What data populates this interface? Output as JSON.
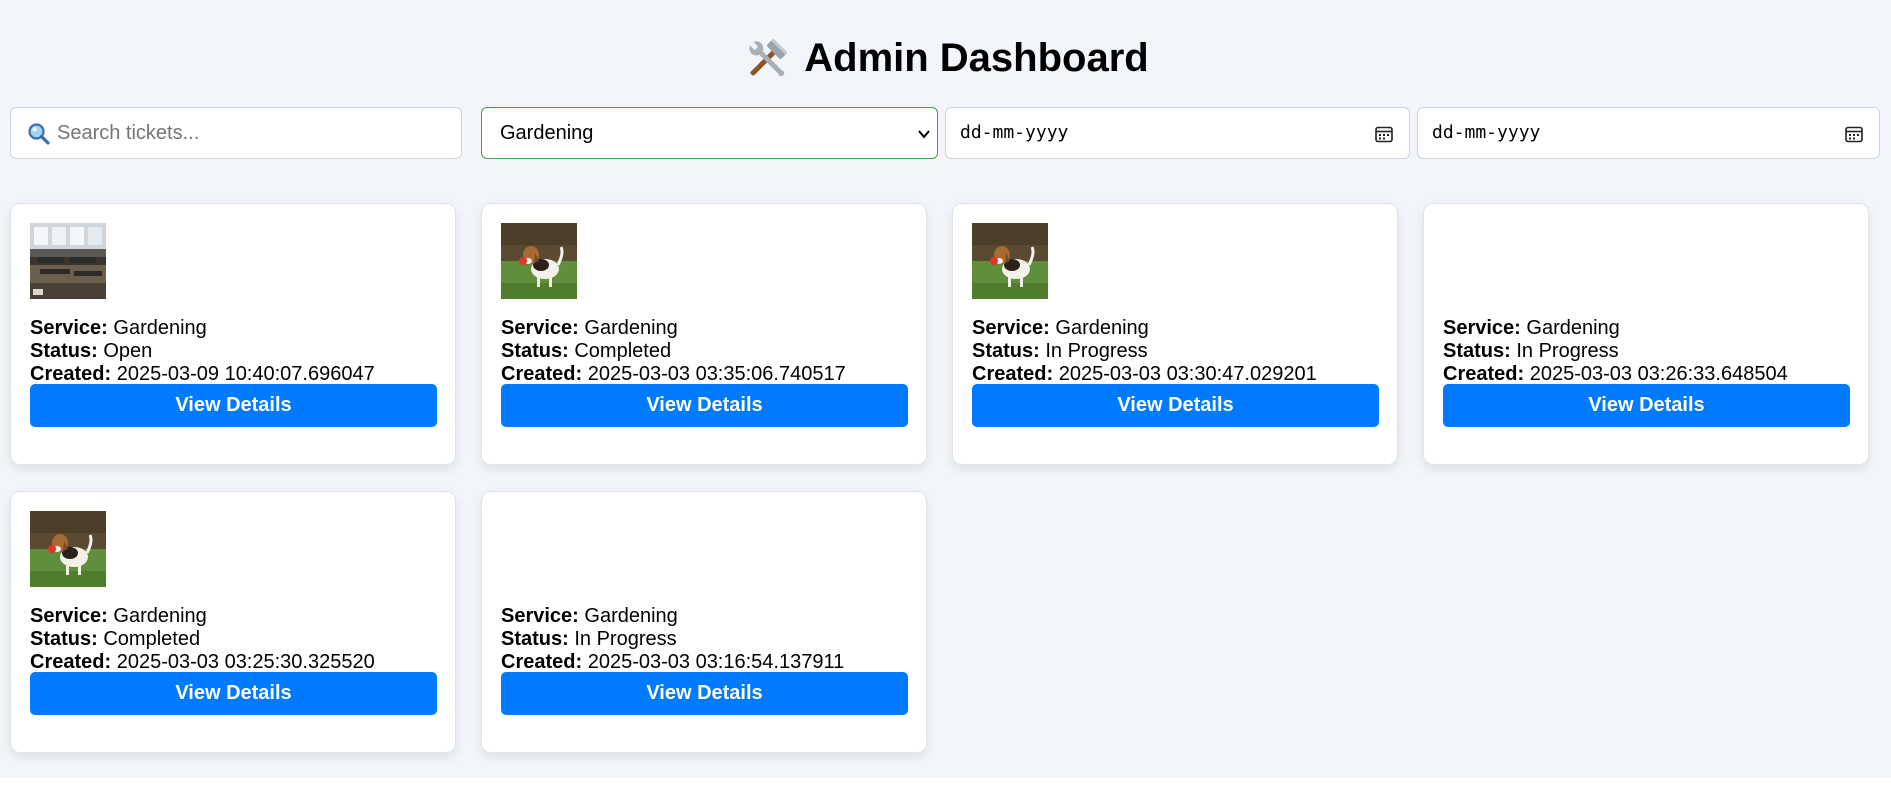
{
  "header": {
    "title": "Admin Dashboard",
    "icon": "hammer-and-wrench-icon"
  },
  "filters": {
    "search": {
      "placeholder": "Search tickets...",
      "icon": "search-icon"
    },
    "service_select": {
      "selected": "Gardening",
      "accent_border": "#43a047"
    },
    "date_from": {
      "value": "dd-mm-yyyy",
      "icon": "calendar-icon"
    },
    "date_to": {
      "value": "dd-mm-yyyy",
      "icon": "calendar-icon"
    }
  },
  "labels": {
    "service": "Service:",
    "status": "Status:",
    "created": "Created:",
    "view_details": "View Details"
  },
  "colors": {
    "button": "#007bff",
    "page_background": "#f2f5f9"
  },
  "tickets": [
    {
      "image": "classroom-photo",
      "service": "Gardening",
      "status": "Open",
      "created": "2025-03-09 10:40:07.696047"
    },
    {
      "image": "dog-photo",
      "service": "Gardening",
      "status": "Completed",
      "created": "2025-03-03 03:35:06.740517"
    },
    {
      "image": "dog-photo",
      "service": "Gardening",
      "status": "In Progress",
      "created": "2025-03-03 03:30:47.029201"
    },
    {
      "image": "none",
      "service": "Gardening",
      "status": "In Progress",
      "created": "2025-03-03 03:26:33.648504"
    },
    {
      "image": "dog-photo",
      "service": "Gardening",
      "status": "Completed",
      "created": "2025-03-03 03:25:30.325520"
    },
    {
      "image": "none",
      "service": "Gardening",
      "status": "In Progress",
      "created": "2025-03-03 03:16:54.137911"
    }
  ]
}
